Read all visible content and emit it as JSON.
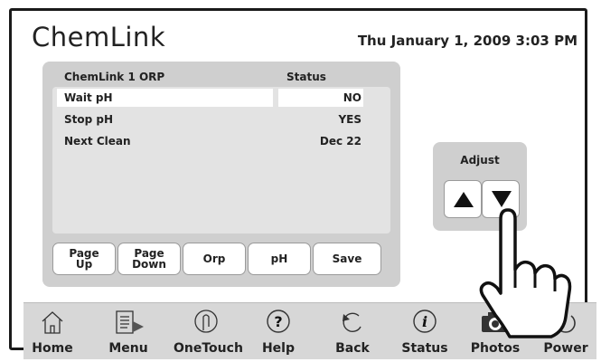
{
  "header": {
    "brand": "ChemLink",
    "datetime": "Thu January 1, 2009  3:03 PM"
  },
  "panel": {
    "title": "ChemLink 1 ORP",
    "column": "Status",
    "rows": [
      {
        "name": "Wait pH",
        "value": "NO"
      },
      {
        "name": "Stop pH",
        "value": "YES"
      },
      {
        "name": "Next Clean",
        "value": "Dec 22"
      }
    ]
  },
  "tabs": [
    {
      "label": "Page Up"
    },
    {
      "label": "Page Down"
    },
    {
      "label": "Orp"
    },
    {
      "label": "pH"
    },
    {
      "label": "Save"
    }
  ],
  "adjust": {
    "label": "Adjust",
    "up_icon": "up-triangle-icon",
    "down_icon": "down-triangle-icon"
  },
  "nav": [
    {
      "label": "Home",
      "icon": "home-icon"
    },
    {
      "label": "Menu",
      "icon": "menu-icon"
    },
    {
      "label": "OneTouch",
      "icon": "onetouch-icon"
    },
    {
      "label": "Help",
      "icon": "help-icon"
    },
    {
      "label": "Back",
      "icon": "back-icon"
    },
    {
      "label": "Status",
      "icon": "status-icon"
    },
    {
      "label": "Photos",
      "icon": "camera-icon"
    },
    {
      "label": "Power",
      "icon": "power-icon"
    }
  ]
}
